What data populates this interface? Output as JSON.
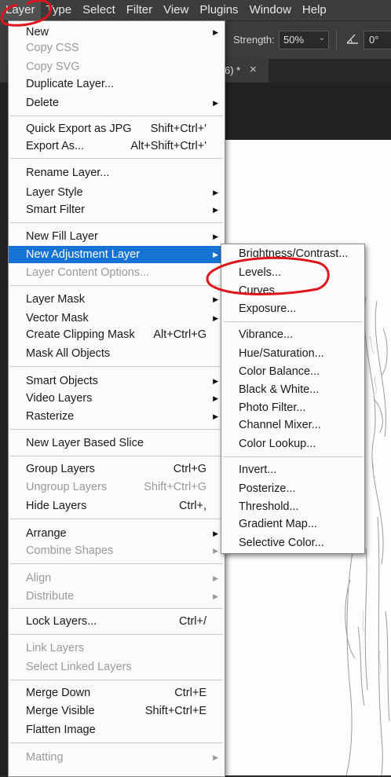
{
  "menubar": {
    "items": [
      "Layer",
      "Type",
      "Select",
      "Filter",
      "View",
      "Plugins",
      "Window",
      "Help"
    ]
  },
  "options": {
    "strength_label": "Strength:",
    "strength_value": "50%",
    "angle_value": "0°"
  },
  "tab": {
    "title": "6) *",
    "close": "×"
  },
  "layer_menu": {
    "items": [
      {
        "label": "New",
        "submenu": true
      },
      {
        "label": "Copy CSS",
        "disabled": true
      },
      {
        "label": "Copy SVG",
        "disabled": true
      },
      {
        "label": "Duplicate Layer..."
      },
      {
        "label": "Delete",
        "submenu": true
      },
      {
        "label": "Quick Export as JPG",
        "shortcut": "Shift+Ctrl+'"
      },
      {
        "label": "Export As...",
        "shortcut": "Alt+Shift+Ctrl+'"
      },
      {
        "label": "Rename Layer..."
      },
      {
        "label": "Layer Style",
        "submenu": true
      },
      {
        "label": "Smart Filter",
        "submenu": true
      },
      {
        "label": "New Fill Layer",
        "submenu": true
      },
      {
        "label": "New Adjustment Layer",
        "submenu": true,
        "highlighted": true
      },
      {
        "label": "Layer Content Options...",
        "disabled": true
      },
      {
        "label": "Layer Mask",
        "submenu": true
      },
      {
        "label": "Vector Mask",
        "submenu": true
      },
      {
        "label": "Create Clipping Mask",
        "shortcut": "Alt+Ctrl+G"
      },
      {
        "label": "Mask All Objects"
      },
      {
        "label": "Smart Objects",
        "submenu": true
      },
      {
        "label": "Video Layers",
        "submenu": true
      },
      {
        "label": "Rasterize",
        "submenu": true
      },
      {
        "label": "New Layer Based Slice"
      },
      {
        "label": "Group Layers",
        "shortcut": "Ctrl+G"
      },
      {
        "label": "Ungroup Layers",
        "shortcut": "Shift+Ctrl+G",
        "disabled": true
      },
      {
        "label": "Hide Layers",
        "shortcut": "Ctrl+,"
      },
      {
        "label": "Arrange",
        "submenu": true
      },
      {
        "label": "Combine Shapes",
        "submenu": true,
        "disabled": true
      },
      {
        "label": "Align",
        "submenu": true,
        "disabled": true
      },
      {
        "label": "Distribute",
        "submenu": true,
        "disabled": true
      },
      {
        "label": "Lock Layers...",
        "shortcut": "Ctrl+/"
      },
      {
        "label": "Link Layers",
        "disabled": true
      },
      {
        "label": "Select Linked Layers",
        "disabled": true
      },
      {
        "label": "Merge Down",
        "shortcut": "Ctrl+E"
      },
      {
        "label": "Merge Visible",
        "shortcut": "Shift+Ctrl+E"
      },
      {
        "label": "Flatten Image"
      },
      {
        "label": "Matting",
        "submenu": true,
        "disabled": true
      }
    ]
  },
  "adjustment_menu": {
    "items": [
      "Brightness/Contrast...",
      "Levels...",
      "Curves...",
      "Exposure...",
      "Vibrance...",
      "Hue/Saturation...",
      "Color Balance...",
      "Black & White...",
      "Photo Filter...",
      "Channel Mixer...",
      "Color Lookup...",
      "Invert...",
      "Posterize...",
      "Threshold...",
      "Gradient Map...",
      "Selective Color..."
    ]
  },
  "colors": {
    "highlight": "#1673d4",
    "annotation": "#e0141c",
    "menu_bg": "#fbfbfb",
    "disabled_text": "#9a9a9a"
  }
}
